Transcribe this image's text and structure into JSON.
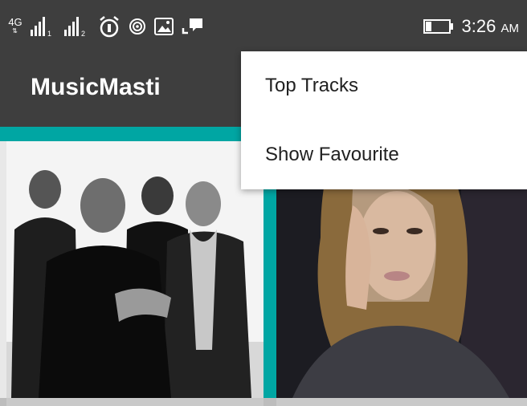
{
  "status_bar": {
    "network_type": "4G",
    "sim1_label": "1",
    "sim2_label": "2",
    "time": "3:26",
    "meridiem": "AM",
    "background": "#3e3e3e",
    "icons": [
      "signal-sim1-icon",
      "signal-sim2-icon",
      "alarm-icon",
      "hotspot-icon",
      "gallery-notification-icon",
      "chat-notification-icon",
      "battery-icon"
    ]
  },
  "app_bar": {
    "title": "MusicMasti",
    "background": "#3e3e3e",
    "accent": "#00a6a3"
  },
  "menu": {
    "items": [
      {
        "label": "Top Tracks"
      },
      {
        "label": "Show Favourite"
      }
    ]
  },
  "grid": {
    "tiles": [
      {
        "name": "band-photo-tile"
      },
      {
        "name": "singer-photo-tile"
      }
    ]
  }
}
